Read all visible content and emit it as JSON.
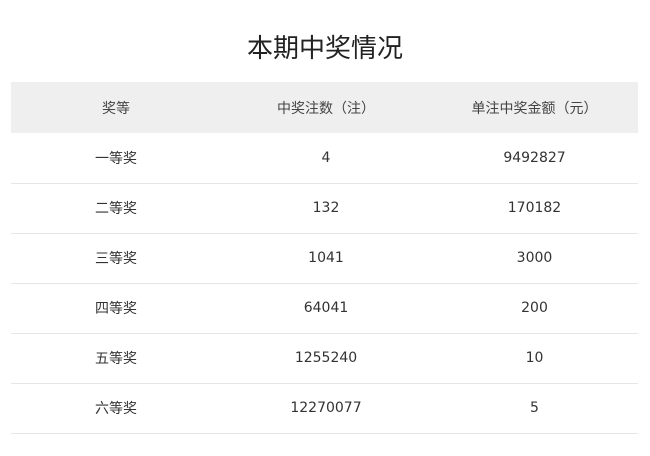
{
  "title": "本期中奖情况",
  "table": {
    "headers": [
      "奖等",
      "中奖注数（注）",
      "单注中奖金额（元）"
    ],
    "rows": [
      {
        "level": "一等奖",
        "count": "4",
        "amount": "9492827"
      },
      {
        "level": "二等奖",
        "count": "132",
        "amount": "170182"
      },
      {
        "level": "三等奖",
        "count": "1041",
        "amount": "3000"
      },
      {
        "level": "四等奖",
        "count": "64041",
        "amount": "200"
      },
      {
        "level": "五等奖",
        "count": "1255240",
        "amount": "10"
      },
      {
        "level": "六等奖",
        "count": "12270077",
        "amount": "5"
      }
    ]
  }
}
